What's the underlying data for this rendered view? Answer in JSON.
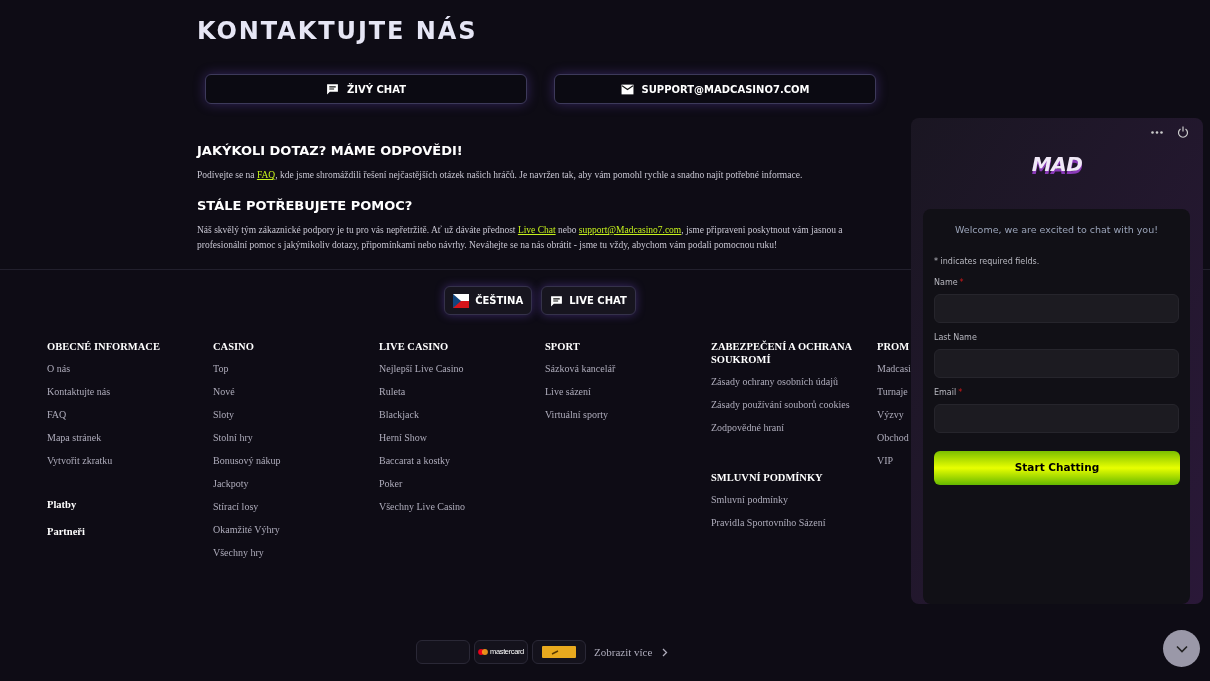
{
  "contact": {
    "title": "KONTAKTUJTE NÁS",
    "buttons": [
      {
        "kind": "chat",
        "label": "ŽIVÝ CHAT"
      },
      {
        "kind": "mail",
        "label": "SUPPORT@MADCASINO7.COM"
      }
    ],
    "sections": [
      {
        "title": "JAKÝKOLI DOTAZ? MÁME ODPOVĚDI!",
        "parts": [
          {
            "text": "Podívejte se na ",
            "link": false
          },
          {
            "text": "FAQ",
            "link": true
          },
          {
            "text": ", kde jsme shromáždili řešení nejčastějších otázek našich hráčů. Je navržen tak, aby vám pomohl rychle a snadno najít potřebné informace.",
            "link": false
          }
        ]
      },
      {
        "title": "STÁLE POTŘEBUJETE POMOC?",
        "parts": [
          {
            "text": "Náš skvělý tým zákaznické podpory je tu pro vás nepřetržitě. Ať už dáváte přednost ",
            "link": false
          },
          {
            "text": "Live Chat",
            "link": true
          },
          {
            "text": " nebo ",
            "link": false
          },
          {
            "text": "support@Madcasino7.com",
            "link": true
          },
          {
            "text": ", jsme připraveni poskytnout vám jasnou a profesionální pomoc s jakýmikoliv dotazy, připomínkami nebo návrhy. Neváhejte se na nás obrátit - jsme tu vždy, abychom vám podali pomocnou ruku!",
            "link": false
          }
        ]
      }
    ]
  },
  "language_bar": [
    {
      "kind": "language",
      "label": "ČEŠTINA"
    },
    {
      "kind": "chat",
      "label": "LIVE CHAT"
    }
  ],
  "footer": {
    "columns": [
      {
        "groups": [
          {
            "title": "OBECNÉ INFORMACE",
            "links": [
              "O nás",
              "Kontaktujte nás",
              "FAQ",
              "Mapa stránek",
              "Vytvořit zkratku"
            ]
          },
          {
            "title": "Platby"
          },
          {
            "title": "Partneři"
          }
        ]
      },
      {
        "groups": [
          {
            "title": "CASINO",
            "links": [
              "Top",
              "Nové",
              "Sloty",
              "Stolní hry",
              "Bonusový nákup",
              "Jackpoty",
              "Stírací losy",
              "Okamžité Výhry",
              "Všechny hry"
            ]
          }
        ]
      },
      {
        "groups": [
          {
            "title": "LIVE CASINO",
            "links": [
              "Nejlepší Live Casino",
              "Ruleta",
              "Blackjack",
              "Herní Show",
              "Baccarat a kostky",
              "Poker",
              "Všechny Live Casino"
            ]
          }
        ]
      },
      {
        "groups": [
          {
            "title": "SPORT",
            "links": [
              "Sázková kancelář",
              "Live sázení",
              "Virtuální sporty"
            ]
          }
        ]
      },
      {
        "groups": [
          {
            "title": "ZABEZPEČENÍ A OCHRANA SOUKROMÍ",
            "links": [
              "Zásady ochrany osobních údajů",
              "Zásady používání souborů cookies",
              "Zodpovědné hraní"
            ]
          },
          {
            "title": "SMLUVNÍ PODMÍNKY",
            "links": [
              "Smluvní podmínky",
              "Pravidla Sportovního Sázení"
            ]
          }
        ]
      },
      {
        "groups": [
          {
            "title": "PROM",
            "links": [
              "Madcasi",
              "Turnaje",
              "Výzvy",
              "Obchod",
              "VIP"
            ]
          }
        ]
      }
    ]
  },
  "payments": {
    "methods": [
      {
        "kind": "blank"
      },
      {
        "kind": "mastercard",
        "label": "mastercard"
      },
      {
        "kind": "yellow"
      }
    ],
    "more": "Zobrazit více"
  },
  "chat_widget": {
    "logo": "MAD",
    "welcome": "Welcome, we are excited to chat with you!",
    "required_note": "* indicates required fields.",
    "required_mark": "*",
    "fields": [
      {
        "label": "Name",
        "required": true
      },
      {
        "label": "Last Name",
        "required": false
      },
      {
        "label": "Email",
        "required": true
      }
    ],
    "submit": "Start Chatting"
  }
}
